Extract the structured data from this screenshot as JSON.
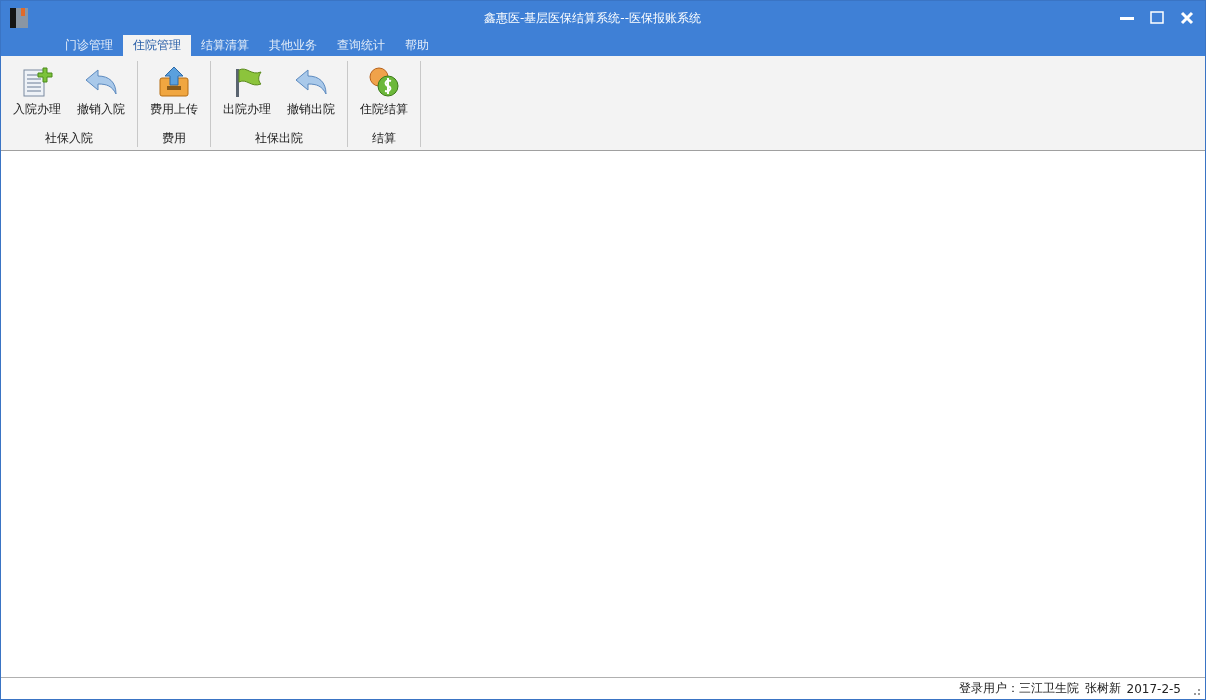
{
  "window": {
    "title": "鑫惠医-基层医保结算系统--医保报账系统"
  },
  "tabs": [
    {
      "label": "门诊管理",
      "selected": false
    },
    {
      "label": "住院管理",
      "selected": true
    },
    {
      "label": "结算清算",
      "selected": false
    },
    {
      "label": "其他业务",
      "selected": false
    },
    {
      "label": "查询统计",
      "selected": false
    },
    {
      "label": "帮助",
      "selected": false
    }
  ],
  "ribbon_groups": [
    {
      "label": "社保入院",
      "buttons": [
        {
          "label": "入院办理",
          "kind": "add-document"
        },
        {
          "label": "撤销入院",
          "kind": "undo"
        }
      ]
    },
    {
      "label": "费用",
      "buttons": [
        {
          "label": "费用上传",
          "kind": "upload"
        }
      ]
    },
    {
      "label": "社保出院",
      "buttons": [
        {
          "label": "出院办理",
          "kind": "flag"
        },
        {
          "label": "撤销出院",
          "kind": "undo"
        }
      ]
    },
    {
      "label": "结算",
      "buttons": [
        {
          "label": "住院结算",
          "kind": "coins"
        }
      ]
    }
  ],
  "status_bar": [
    "登录用户：三江卫生院",
    "张树新",
    "2017-2-5"
  ]
}
